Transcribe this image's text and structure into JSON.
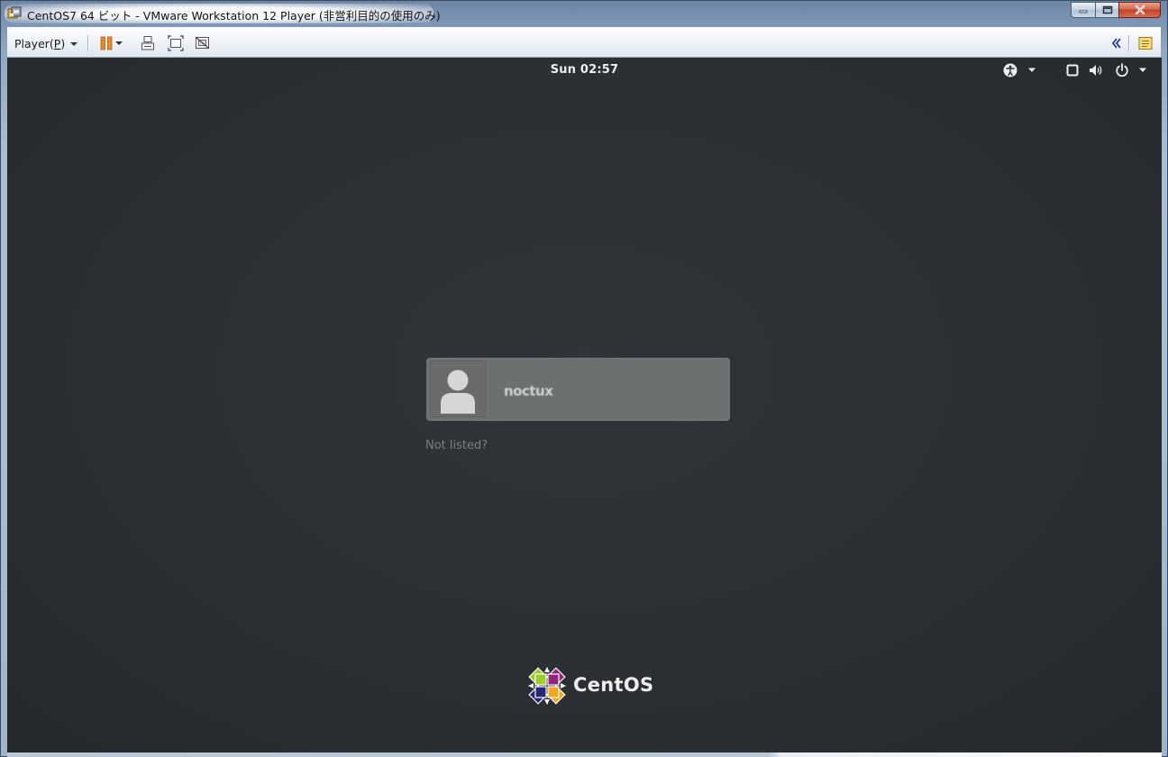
{
  "window": {
    "title": "CentOS7 64 ビット - VMware Workstation 12 Player (非営利目的の使用のみ)",
    "app_icon": "vmware-player-icon"
  },
  "caption_buttons": {
    "minimize_icon": "minimize-icon",
    "maximize_icon": "maximize-icon",
    "close_icon": "close-icon"
  },
  "toolbar": {
    "player_menu_label": "Player(",
    "player_menu_mnemonic": "P",
    "player_menu_close": ")",
    "icons": [
      "pause-icon",
      "send-ctrl-alt-del-icon",
      "fullscreen-icon",
      "unity-icon",
      "collapse-toolbar-icon",
      "message-log-icon"
    ]
  },
  "guest": {
    "clock": "Sun 02:57",
    "panel_icons": [
      "accessibility-icon",
      "screen-icon",
      "volume-icon",
      "power-icon"
    ],
    "user_card": {
      "name": "noctux",
      "avatar_icon": "user-avatar-icon"
    },
    "not_listed": "Not listed?",
    "logo_text": "CentOS",
    "logo_icon": "centos-emblem-icon"
  },
  "colors": {
    "desktop_bg": "#2b2f33",
    "user_card_bg": "#6d7070",
    "clock_text": "#eeeeec",
    "not_listed_text": "#7b7f80",
    "pause_accent": "#e07a22"
  }
}
